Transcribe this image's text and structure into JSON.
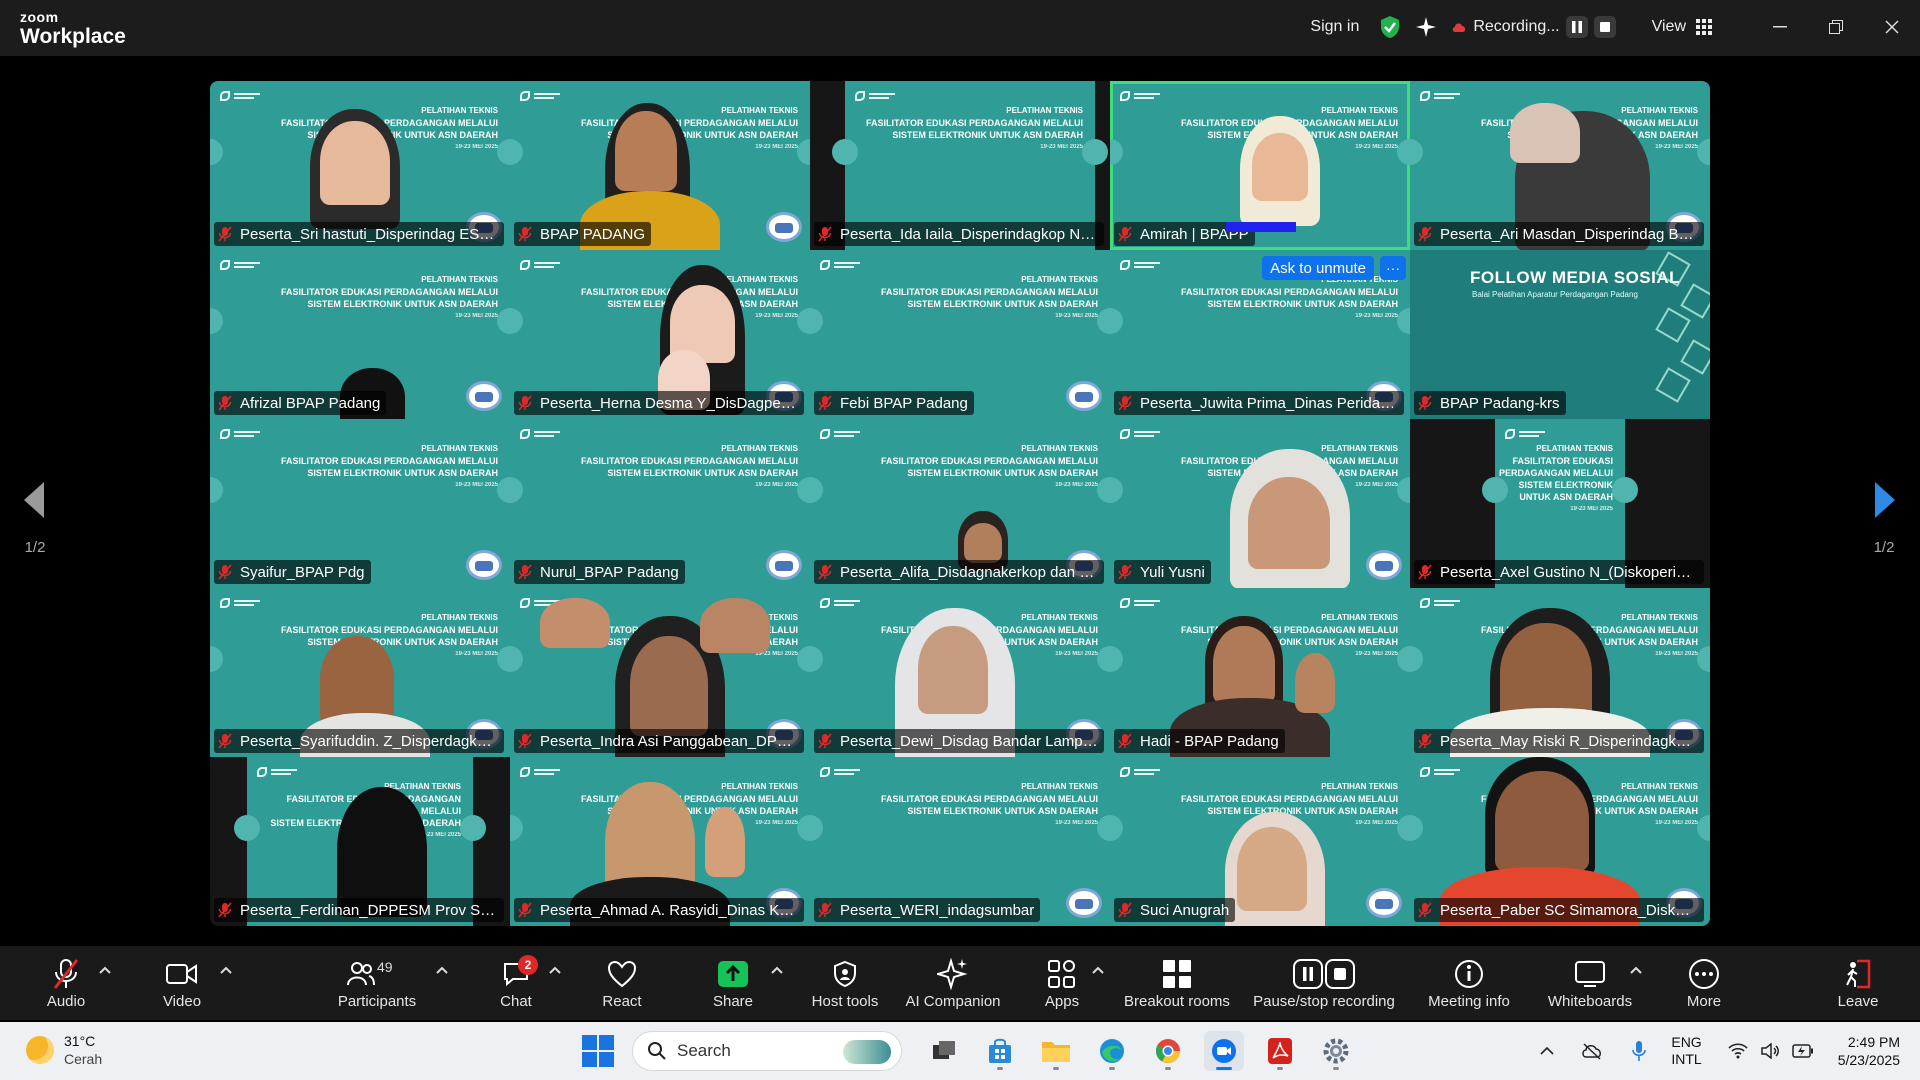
{
  "app": {
    "brand_small": "zoom",
    "brand_big": "Workplace"
  },
  "titlebar": {
    "sign_in": "Sign in",
    "recording": "Recording...",
    "view": "View"
  },
  "banner": {
    "line1": "PELATIHAN TEKNIS",
    "line2": "FASILITATOR EDUKASI PERDAGANGAN MELALUI",
    "line3": "SISTEM ELEKTRONIK UNTUK ASN DAERAH",
    "line4": "19-23 MEI 2025"
  },
  "follow": {
    "title": "FOLLOW MEDIA SOSIAL",
    "subtitle": "Balai Pelatihan Aparatur Perdagangan Padang"
  },
  "ask_to_unmute": "Ask to unmute",
  "more_dots": "···",
  "participants": [
    "Peserta_Sri hastuti_Disperindag ESDM",
    "BPAP PADANG",
    "Peserta_Ida Iaila_Disperindagkop Nat...",
    "Amirah | BPAPP",
    "Peserta_Ari Masdan_Disperindag Bab...",
    "Afrizal BPAP Padang",
    "Peserta_Herna Desma Y_DisDagperin...",
    "Febi BPAP Padang",
    "Peserta_Juwita Prima_Dinas Peridag...",
    "BPAP Padang-krs",
    "Syaifur_BPAP Pdg",
    "Nurul_BPAP Padang",
    "Peserta_Alifa_Disdagnakerkop dan U...",
    "Yuli Yusni",
    "Peserta_Axel Gustino N_(Diskoperind...",
    "Peserta_Syarifuddin. Z_Disperdagkop...",
    "Peserta_Indra Asi Panggabean_DPPE...",
    "Peserta_Dewi_Disdag Bandar Lampu...",
    "Hadi - BPAP Padang",
    "Peserta_May Riski R_Disperindagkop...",
    "Peserta_Ferdinan_DPPESM Prov Sum...",
    "Peserta_Ahmad A. Rasyidi_Dinas KUK...",
    "Peserta_WERI_indagsumbar",
    "Suci Anugrah",
    "Peserta_Paber SC Simamora_Diskope..."
  ],
  "pagination": {
    "left": "1/2",
    "right": "1/2"
  },
  "toolbar": {
    "audio": "Audio",
    "video": "Video",
    "participants": "Participants",
    "participants_count": "49",
    "chat": "Chat",
    "chat_badge": "2",
    "react": "React",
    "share": "Share",
    "host_tools": "Host tools",
    "ai_companion": "AI Companion",
    "apps": "Apps",
    "breakout_rooms": "Breakout rooms",
    "pause_stop_recording": "Pause/stop recording",
    "meeting_info": "Meeting info",
    "whiteboards": "Whiteboards",
    "more": "More",
    "leave": "Leave"
  },
  "taskbar": {
    "temp": "31°C",
    "condition": "Cerah",
    "search_placeholder": "Search",
    "lang1": "ENG",
    "lang2": "INTL",
    "time": "2:49 PM",
    "date": "5/23/2025"
  },
  "colors": {
    "tile_bg": "#2f9c96",
    "active_border": "#3ede7a",
    "zoom_blue": "#0e72ed",
    "share_green": "#16c25a",
    "leave_red": "#e02828"
  }
}
